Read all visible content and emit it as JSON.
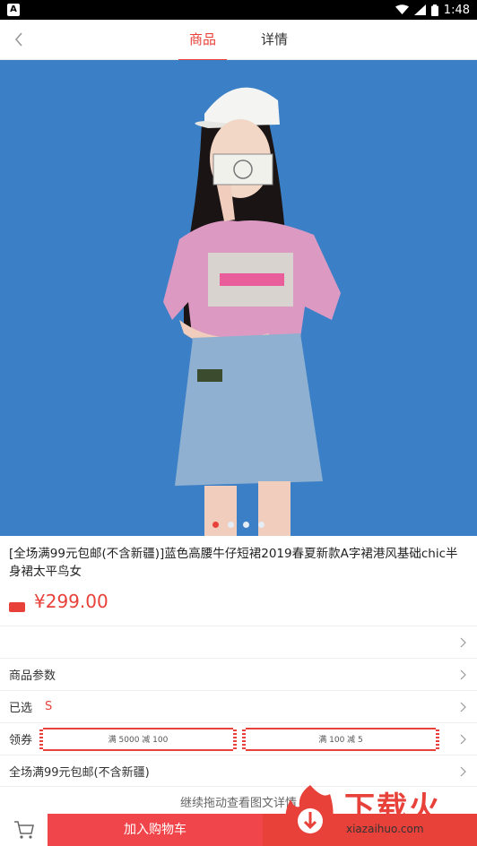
{
  "status_bar": {
    "time": "1:48",
    "notification_glyph": "A"
  },
  "nav": {
    "tabs": [
      {
        "label": "商品",
        "active": true
      },
      {
        "label": "详情",
        "active": false
      }
    ]
  },
  "carousel": {
    "page_count": 4,
    "current_page": 1,
    "background_color": "#3b80c6"
  },
  "product": {
    "title": "[全场满99元包邮(不含新疆)]蓝色高腰牛仔短裙2019春夏新款A字裙港风基础chic半身裙太平鸟女",
    "price": "¥299.00"
  },
  "rows": {
    "params_label": "商品参数",
    "selected_label": "已选",
    "selected_value": "S",
    "coupon_label": "领券",
    "coupons": [
      "满 5000 减 100",
      "满 100 减 5"
    ],
    "shipping_label": "全场满99元包邮(不含新疆)"
  },
  "detail_hint": "继续拖动查看图文详情",
  "bottom": {
    "add_to_cart_label": "加入购物车"
  },
  "watermark": {
    "title": "下载火",
    "subtitle": "xiazaihuo.com"
  },
  "colors": {
    "accent": "#e8413a"
  }
}
